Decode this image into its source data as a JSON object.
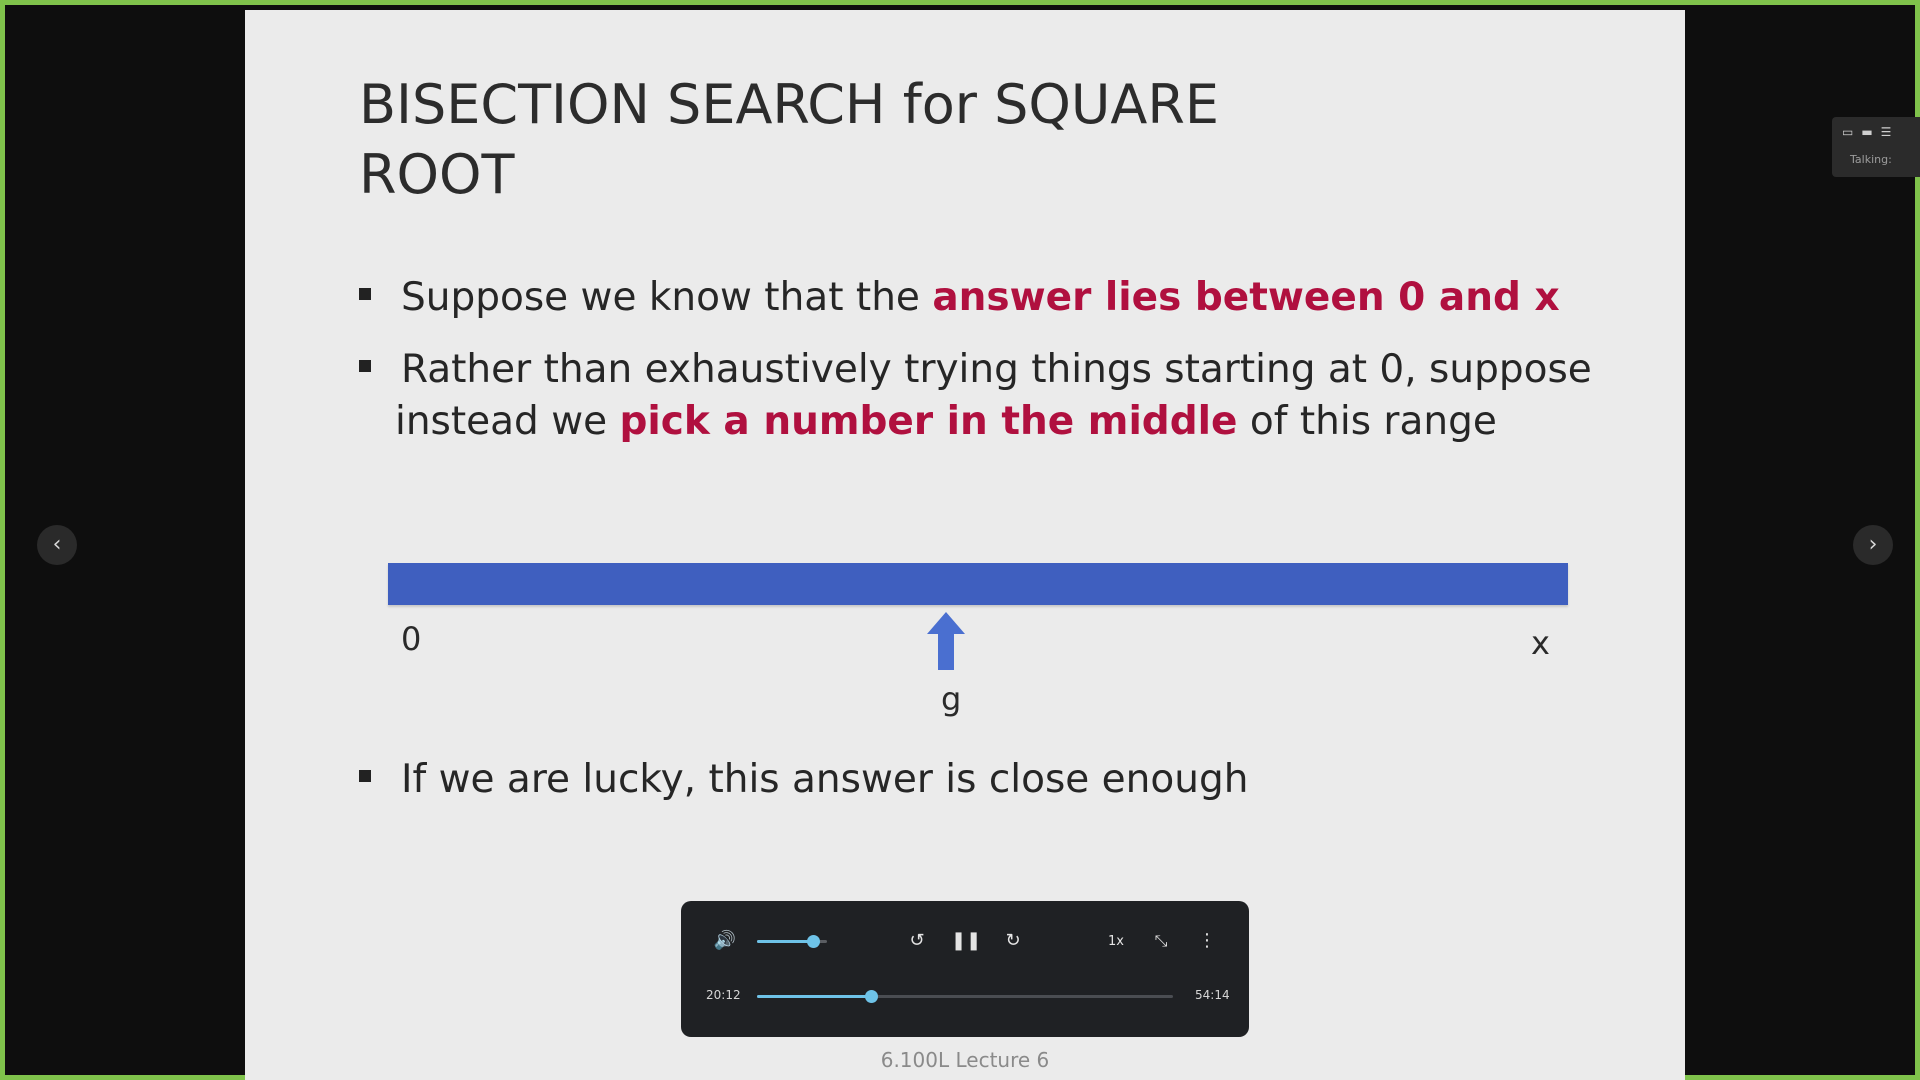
{
  "slide": {
    "title": "BISECTION SEARCH for SQUARE ROOT",
    "bullets": [
      {
        "pre": "Suppose we know that the ",
        "highlight": "answer lies between 0 and x",
        "post": ""
      },
      {
        "pre": "Rather than exhaustively trying things starting at 0, suppose",
        "line2_pre": "instead we ",
        "highlight": "pick a number in the middle",
        "post": " of this range"
      },
      {
        "pre": "If we are lucky, this answer is close enough",
        "highlight": "",
        "post": ""
      }
    ],
    "number_line": {
      "start_label": "0",
      "end_label": "x",
      "guess_label": "g",
      "bar_color": "#3f5fbf",
      "arrow_color": "#4a6fd0"
    },
    "highlight_color": "#b0103f",
    "footer": "6.100L Lecture 6"
  },
  "navigation": {
    "prev_icon": "chevron-left-icon",
    "next_icon": "chevron-right-icon",
    "prev_glyph": "‹",
    "next_glyph": "›"
  },
  "mini_panel": {
    "label": "Talking:"
  },
  "player": {
    "volume_icon_glyph": "🔊",
    "rewind_glyph": "↺",
    "pause_glyph": "❚❚",
    "forward_glyph": "↻",
    "speed_label": "1x",
    "exit_fullscreen_glyph": "⤡",
    "more_glyph": "⋮",
    "current_time": "20:12",
    "duration": "54:14",
    "volume_level": 0.8,
    "progress": 0.273,
    "accent_color": "#6ec3e8"
  }
}
